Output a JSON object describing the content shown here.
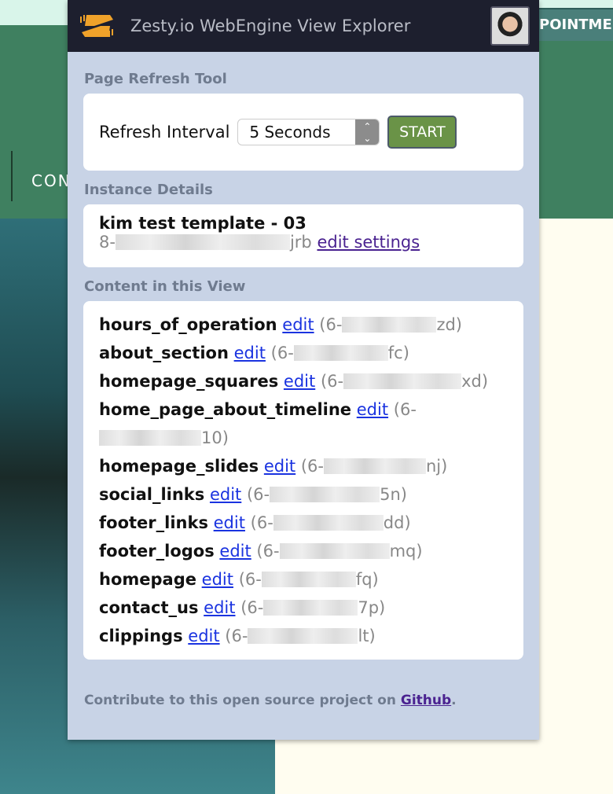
{
  "background": {
    "nav_text": "CON",
    "appointment_button": "POINTMEN"
  },
  "header": {
    "title": "Zesty.io WebEngine View Explorer",
    "logo": "zesty-logo-icon",
    "avatar": "user-avatar"
  },
  "refresh": {
    "heading": "Page Refresh Tool",
    "label": "Refresh Interval",
    "selected": "5 Seconds",
    "start": "START"
  },
  "instance": {
    "heading": "Instance Details",
    "name": "kim test template - 03",
    "id_prefix": "8-",
    "id_suffix": "jrb",
    "edit_settings": "edit settings"
  },
  "content": {
    "heading": "Content in this View",
    "edit_label": "edit",
    "items": [
      {
        "name": "hours_of_operation",
        "id_start": "(6-",
        "id_end": "zd)"
      },
      {
        "name": "about_section",
        "id_start": "(6-",
        "id_end": "fc)"
      },
      {
        "name": "homepage_squares",
        "id_start": "(6-",
        "id_end": "xd)"
      },
      {
        "name": "home_page_about_timeline",
        "id_start": "(6-",
        "id_end": "10)"
      },
      {
        "name": "homepage_slides",
        "id_start": "(6-",
        "id_end": "nj)"
      },
      {
        "name": "social_links",
        "id_start": "(6-",
        "id_end": "5n)"
      },
      {
        "name": "footer_links",
        "id_start": "(6-",
        "id_end": "dd)"
      },
      {
        "name": "footer_logos",
        "id_start": "(6-",
        "id_end": "mq)"
      },
      {
        "name": "homepage",
        "id_start": "(6-",
        "id_end": "fq)"
      },
      {
        "name": "contact_us",
        "id_start": "(6-",
        "id_end": "7p)"
      },
      {
        "name": "clippings",
        "id_start": "(6-",
        "id_end": "lt)"
      }
    ]
  },
  "footer": {
    "text": "Contribute to this open source project on ",
    "link": "Github",
    "end": "."
  },
  "colors": {
    "header_bg": "#1d1f2e",
    "panel_bg": "#c8d3e6",
    "start_button": "#6a9347",
    "link": "#1a33e0"
  }
}
